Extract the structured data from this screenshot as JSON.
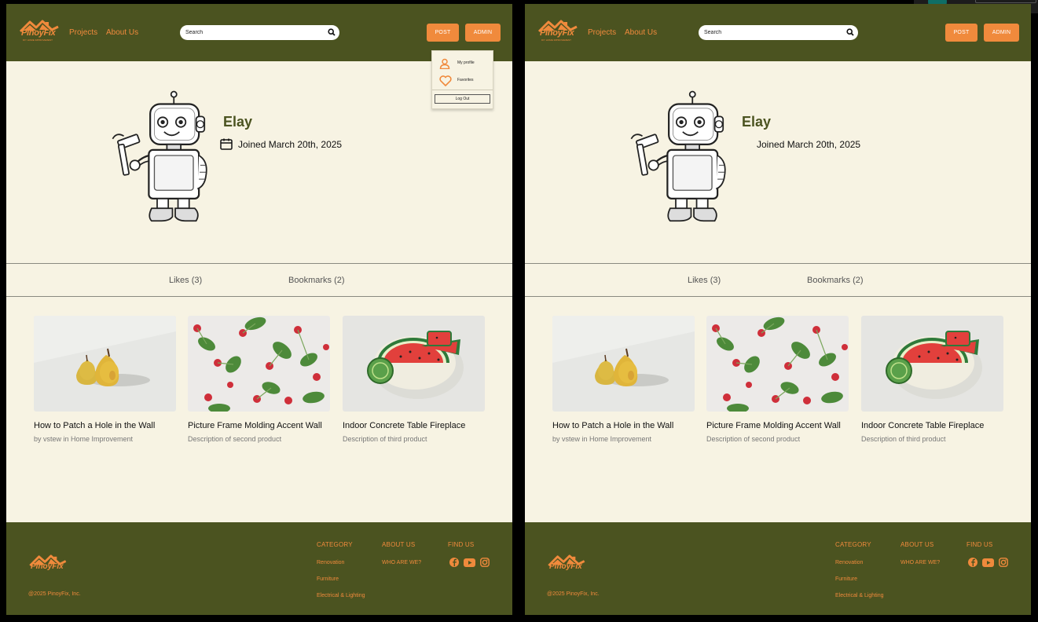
{
  "header": {
    "logo_text": "PinoyFix",
    "logo_tagline": "DIY HOME IMPROVEMENT",
    "nav": [
      "Projects",
      "About Us"
    ],
    "search_placeholder": "Search",
    "post_label": "POST",
    "admin_label": "ADMIN",
    "colors": {
      "bar": "#4b5320",
      "accent": "#f08a3c",
      "page": "#f7f3e3"
    }
  },
  "dropdown": {
    "items": [
      {
        "label": "My profile",
        "icon": "user-icon"
      },
      {
        "label": "Favorites",
        "icon": "heart-icon"
      }
    ],
    "logout_label": "Log Out"
  },
  "profile": {
    "name": "Elay",
    "joined": "Joined March 20th, 2025"
  },
  "tabs": [
    "Likes (3)",
    "Bookmarks (2)"
  ],
  "cards": [
    {
      "title": "How to Patch a Hole in the Wall",
      "description": "by vstew in Home Improvement",
      "image": "pears-photo"
    },
    {
      "title": "Picture Frame Molding Accent Wall",
      "description": "Description of second product",
      "image": "radishes-photo"
    },
    {
      "title": "Indoor Concrete Table Fireplace",
      "description": "Description of third product",
      "image": "watermelon-photo"
    }
  ],
  "footer": {
    "copyright": "@2025 PinoyFix, Inc.",
    "category_heading": "CATEGORY",
    "categories": [
      "Renovation",
      "Furniture",
      "Electrical & Lighting"
    ],
    "about_heading": "ABOUT US",
    "about_links": [
      "WHO ARE WE?"
    ],
    "find_heading": "FIND US",
    "social": [
      "facebook-icon",
      "youtube-icon",
      "instagram-icon"
    ]
  }
}
